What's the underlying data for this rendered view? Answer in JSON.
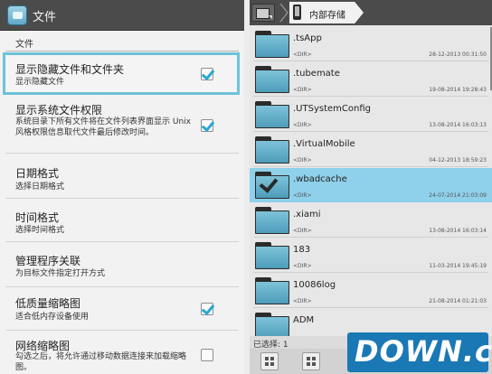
{
  "settings": {
    "app_title": "文件",
    "section_header": "文件",
    "items": [
      {
        "title": "显示隐藏文件和文件夹",
        "summary": "显示隐藏文件",
        "checked": true
      },
      {
        "title": "显示系统文件权限",
        "summary": "系统目录下所有文件将在文件列表界面显示 Unix 风格权限信息取代文件最后修改时间。",
        "checked": true
      },
      {
        "title": "日期格式",
        "summary": "选择日期格式"
      },
      {
        "title": "时间格式",
        "summary": "选择时间格式"
      },
      {
        "title": "管理程序关联",
        "summary": "为目标文件指定打开方式"
      },
      {
        "title": "低质量缩略图",
        "summary": "适合低内存设备使用",
        "checked": true
      },
      {
        "title": "网络缩略图",
        "summary": "勾选之后，将允许通过移动数据连接来加载缩略图。",
        "checked": false
      }
    ]
  },
  "browser": {
    "breadcrumb": "内部存储",
    "files": [
      {
        "name": ".tsApp",
        "type": "<DIR>",
        "date": "28-12-2013 00:31:50"
      },
      {
        "name": ".tubemate",
        "type": "<DIR>",
        "date": "19-08-2014 19:28:43"
      },
      {
        "name": ".UTSystemConfig",
        "type": "<DIR>",
        "date": "13-08-2014 16:03:13"
      },
      {
        "name": ".VirtualMobile",
        "type": "<DIR>",
        "date": "04-12-2013 18:59:23"
      },
      {
        "name": ".wbadcache",
        "type": "<DIR>",
        "date": "24-07-2014 21:03:09",
        "selected": true
      },
      {
        "name": ".xiami",
        "type": "<DIR>",
        "date": "13-08-2014 16:03:14"
      },
      {
        "name": "183",
        "type": "<DIR>",
        "date": "11-03-2014 19:45:19"
      },
      {
        "name": "10086log",
        "type": "<DIR>",
        "date": "21-08-2014 01:21:03"
      },
      {
        "name": "ADM",
        "type": "",
        "date": ""
      }
    ],
    "status_text": "已选择: 1"
  },
  "watermark": "DOWN.cc",
  "colors": {
    "accent": "#6dc2d9",
    "selection": "#8fd0ea",
    "check": "#2aa6d4",
    "folder": "#5ea9c8",
    "watermark_bg": "#1a78b4"
  }
}
